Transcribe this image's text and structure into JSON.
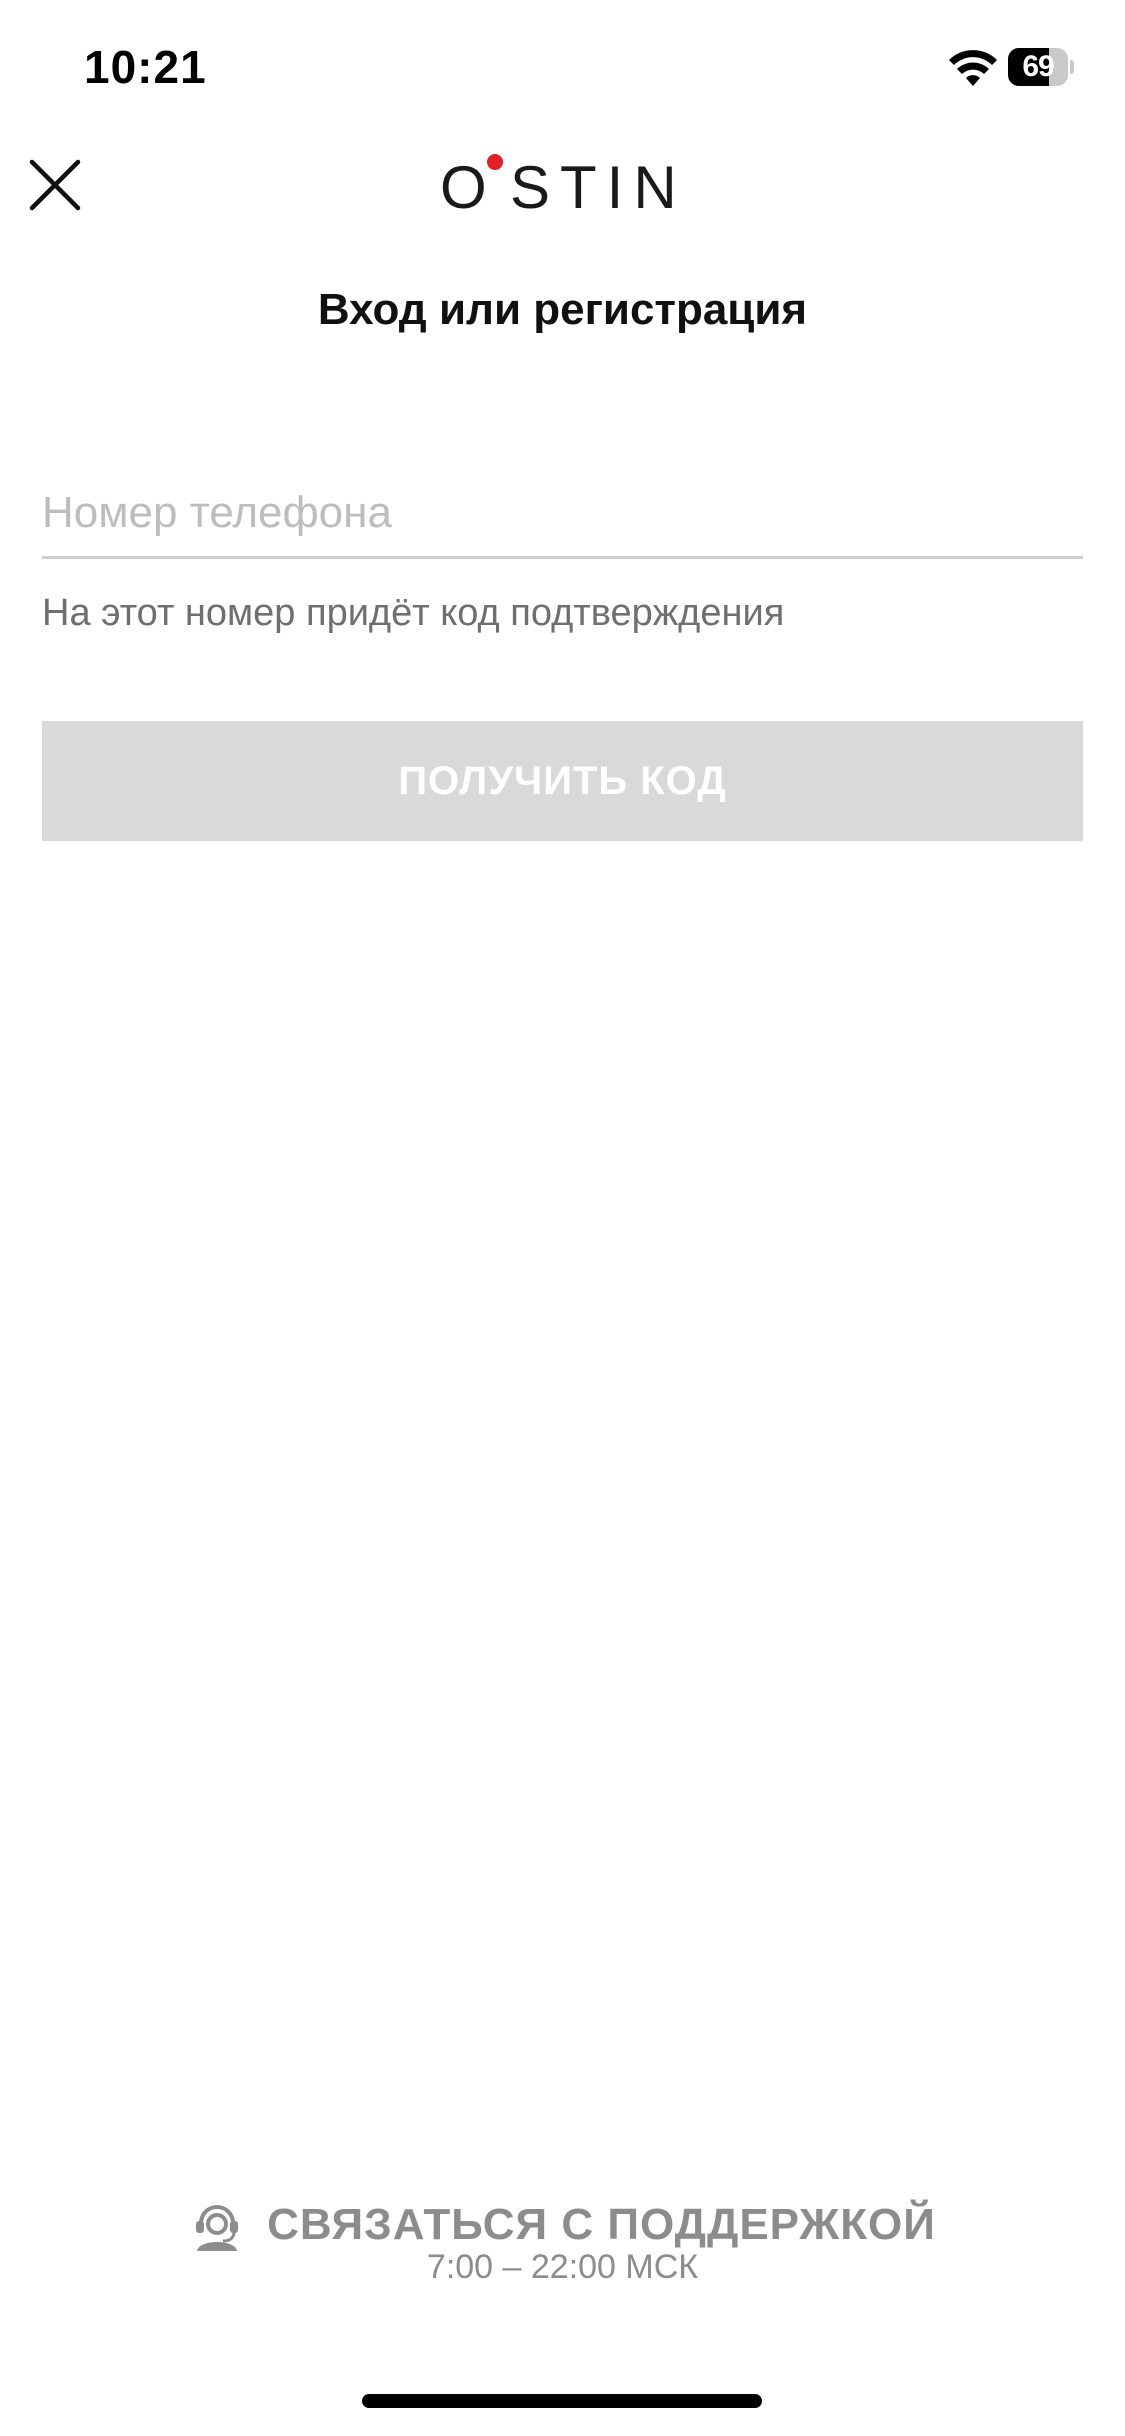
{
  "status_bar": {
    "time": "10:21",
    "battery_level": "69",
    "battery_percent": 69,
    "icons": [
      "wifi-icon",
      "battery-icon"
    ]
  },
  "header": {
    "close_icon": "close-icon",
    "logo": "O'STIN",
    "logo_dot_color": "#e31e24"
  },
  "title": "Вход или регистрация",
  "phone": {
    "placeholder": "Номер телефона",
    "value": "",
    "hint": "На этот номер придёт код подтверждения"
  },
  "actions": {
    "get_code_label": "ПОЛУЧИТЬ КОД",
    "button_bg": "#d9d9d9"
  },
  "support": {
    "icon": "support-headset-icon",
    "label": "СВЯЗАТЬСЯ С ПОДДЕРЖКОЙ",
    "hours": "7:00 – 22:00 МСК"
  }
}
